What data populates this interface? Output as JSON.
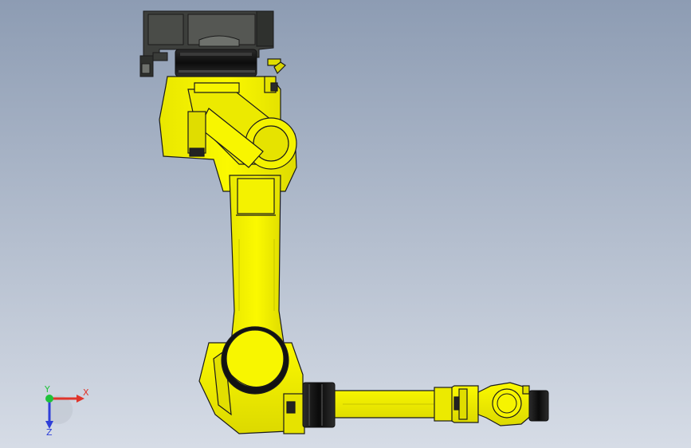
{
  "triad": {
    "x_label": "X",
    "y_label": "Y",
    "z_label": "Z",
    "x_color": "#e0342a",
    "y_color": "#1fc23a",
    "z_color": "#2f3fd8"
  },
  "colors": {
    "background_top": "#8d9cb3",
    "background_bottom": "#d6dce6",
    "robot_yellow": "#f6f400",
    "robot_shadow": "#c9c600",
    "mount_dark": "#3d3f3c",
    "mount_grey": "#6e716c",
    "ring_black": "#121212",
    "outline": "#1a1a1a"
  },
  "icons": {
    "model": "industrial-robot-arm",
    "triad": "axis-triad-icon"
  }
}
